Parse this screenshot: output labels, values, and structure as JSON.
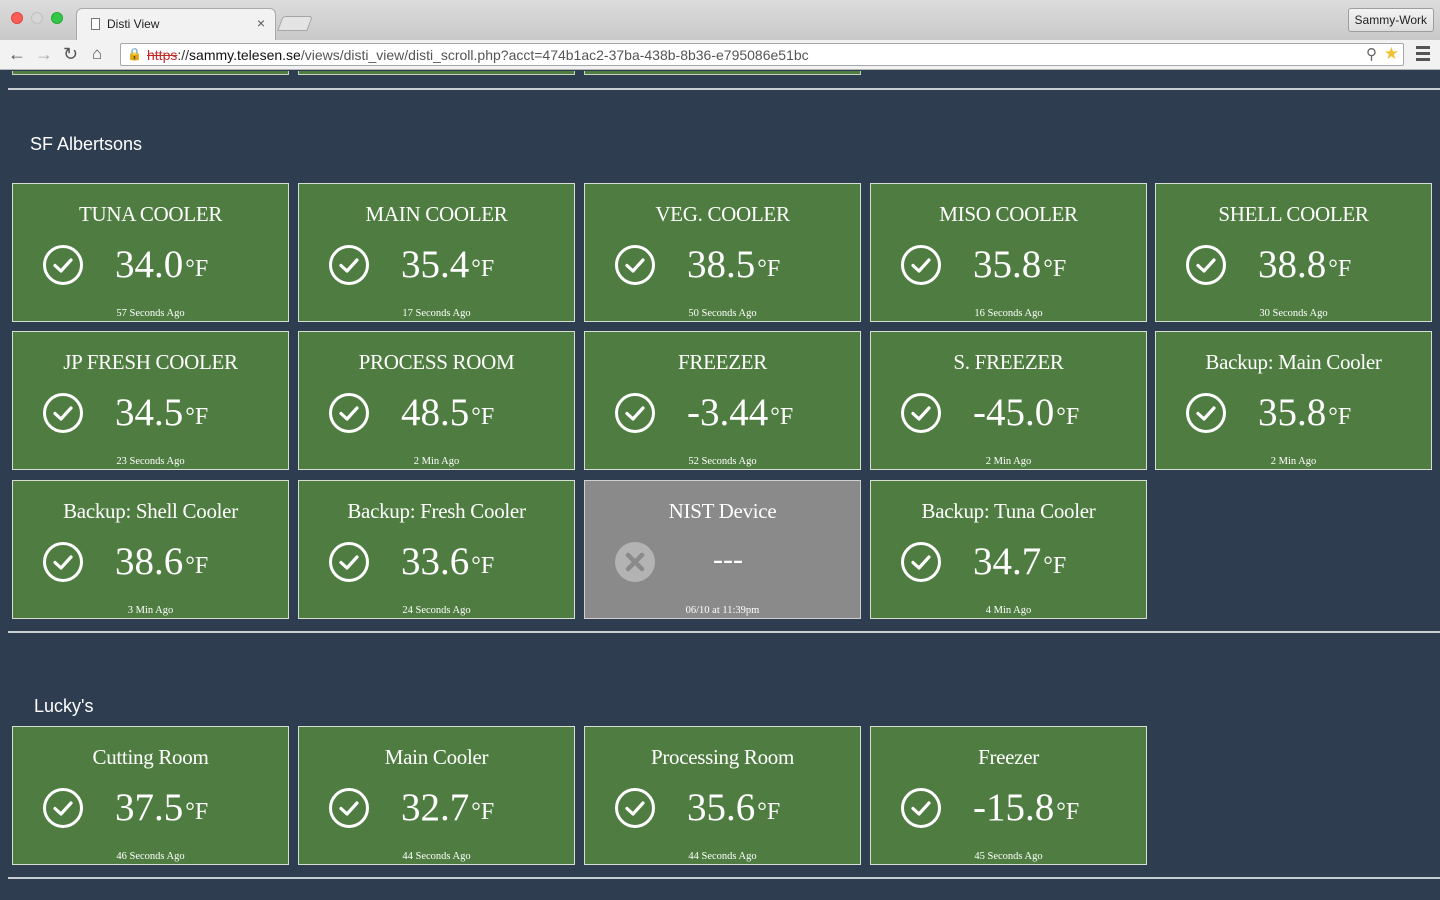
{
  "browser": {
    "tab_title": "Disti View",
    "tab_close": "×",
    "profile": "Sammy-Work",
    "url_scheme": "https",
    "url_sep": "://",
    "url_host": "sammy.telesen.se",
    "url_path": "/views/disti_view/disti_scroll.php?acct=474b1ac2-37ba-438b-8b36-e795086e51bc",
    "icons": [
      "back-icon",
      "forward-icon",
      "reload-icon",
      "home-icon",
      "insecure-lock-icon",
      "search-icon",
      "bookmark-star-icon",
      "menu-icon"
    ]
  },
  "colors": {
    "page_bg": "#2e3d50",
    "card_ok": "#4f7d41",
    "card_offline": "#8a8a8a"
  },
  "sections": [
    {
      "name": "SF Albertsons",
      "sensors": [
        {
          "name": "TUNA COOLER",
          "value": "34.0",
          "unit": "°F",
          "time": "57 Seconds Ago",
          "status": "ok"
        },
        {
          "name": "MAIN COOLER",
          "value": "35.4",
          "unit": "°F",
          "time": "17 Seconds Ago",
          "status": "ok"
        },
        {
          "name": "VEG. COOLER",
          "value": "38.5",
          "unit": "°F",
          "time": "50 Seconds Ago",
          "status": "ok"
        },
        {
          "name": "MISO COOLER",
          "value": "35.8",
          "unit": "°F",
          "time": "16 Seconds Ago",
          "status": "ok"
        },
        {
          "name": "SHELL COOLER",
          "value": "38.8",
          "unit": "°F",
          "time": "30 Seconds Ago",
          "status": "ok"
        },
        {
          "name": "JP FRESH COOLER",
          "value": "34.5",
          "unit": "°F",
          "time": "23 Seconds Ago",
          "status": "ok"
        },
        {
          "name": "PROCESS ROOM",
          "value": "48.5",
          "unit": "°F",
          "time": "2 Min Ago",
          "status": "ok"
        },
        {
          "name": "FREEZER",
          "value": "-3.44",
          "unit": "°F",
          "time": "52 Seconds Ago",
          "status": "ok"
        },
        {
          "name": "S. FREEZER",
          "value": "-45.0",
          "unit": "°F",
          "time": "2 Min Ago",
          "status": "ok"
        },
        {
          "name": "Backup: Main Cooler",
          "value": "35.8",
          "unit": "°F",
          "time": "2 Min Ago",
          "status": "ok"
        },
        {
          "name": "Backup: Shell Cooler",
          "value": "38.6",
          "unit": "°F",
          "time": "3 Min Ago",
          "status": "ok"
        },
        {
          "name": "Backup: Fresh Cooler",
          "value": "33.6",
          "unit": "°F",
          "time": "24 Seconds Ago",
          "status": "ok"
        },
        {
          "name": "NIST Device",
          "value": "---",
          "unit": "",
          "time": "06/10 at 11:39pm",
          "status": "offline"
        },
        {
          "name": "Backup: Tuna Cooler",
          "value": "34.7",
          "unit": "°F",
          "time": "4 Min Ago",
          "status": "ok"
        }
      ]
    },
    {
      "name": "Lucky's",
      "sensors": [
        {
          "name": "Cutting Room",
          "value": "37.5",
          "unit": "°F",
          "time": "46 Seconds Ago",
          "status": "ok"
        },
        {
          "name": "Main Cooler",
          "value": "32.7",
          "unit": "°F",
          "time": "44 Seconds Ago",
          "status": "ok"
        },
        {
          "name": "Processing Room",
          "value": "35.6",
          "unit": "°F",
          "time": "44 Seconds Ago",
          "status": "ok"
        },
        {
          "name": "Freezer",
          "value": "-15.8",
          "unit": "°F",
          "time": "45 Seconds Ago",
          "status": "ok"
        }
      ]
    }
  ]
}
